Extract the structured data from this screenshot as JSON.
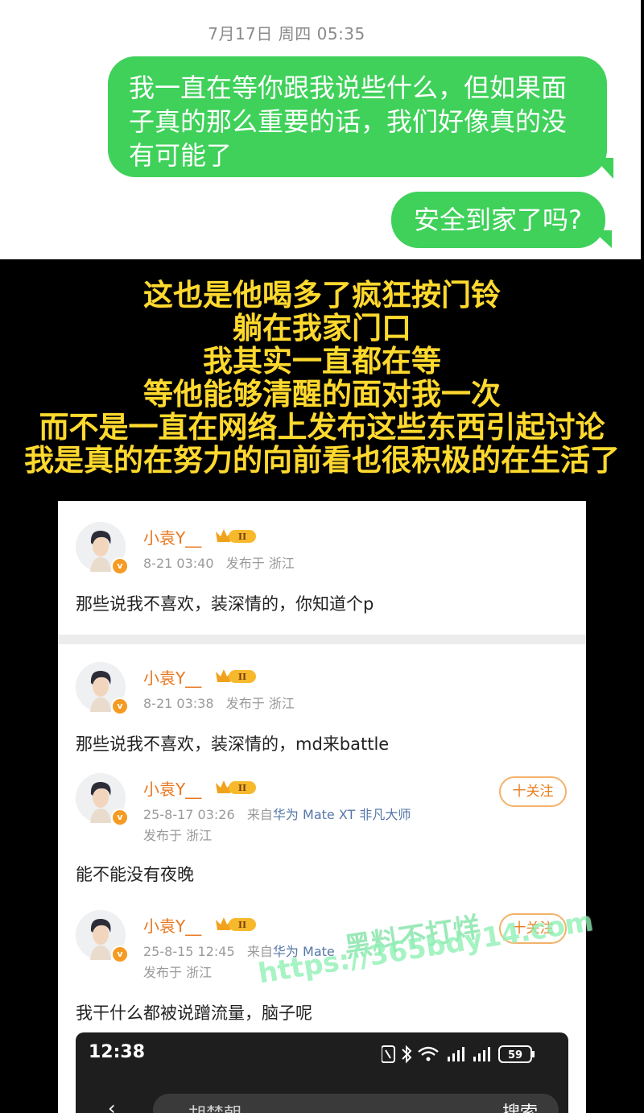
{
  "sms": {
    "timestamp": "7月17日 周四 05:35",
    "messages": [
      {
        "lines": [
          "我一直在等你跟我说些什么，但如果面",
          "子真的那么重要的话，我们好像真的没",
          "有可能了"
        ]
      },
      {
        "lines": [
          "安全到家了吗?"
        ]
      }
    ],
    "bubble_color": "#3fd15a"
  },
  "caption": {
    "lines": [
      "这也是他喝多了疯狂按门铃",
      "躺在我家门口",
      "我其实一直都在等",
      "等他能够清醒的面对我一次",
      "而不是一直在网络上发布这些东西引起讨论",
      "我是真的在努力的向前看也很积极的在生活了"
    ],
    "color": "#ffd92e"
  },
  "weibo": {
    "level_badge": "II",
    "posts": [
      {
        "user": "小袁Y__",
        "time": "8-21 03:40",
        "location": "发布于 浙江",
        "device": "",
        "text": "那些说我不喜欢，装深情的，你知道个p"
      },
      {
        "user": "小袁Y__",
        "time": "8-21 03:38",
        "location": "发布于 浙江",
        "device": "",
        "text": "那些说我不喜欢，装深情的，md来battle"
      },
      {
        "user": "小袁Y__",
        "time": "25-8-17 03:26",
        "source_prefix": "来自",
        "device": "华为 Mate XT 非凡大师",
        "location": "发布于 浙江",
        "text": "能不能没有夜晚",
        "follow": "十关注"
      },
      {
        "user": "小袁Y__",
        "time": "25-8-15 12:45",
        "source_prefix": "来自",
        "device": "华为 Mate",
        "location": "发布于 浙江",
        "text": "我干什么都被说蹭流量，脑子呢",
        "follow": "十关注"
      }
    ]
  },
  "phone": {
    "clock": "12:38",
    "battery": "59",
    "search_text": "胡楚朝",
    "search_button": "搜索"
  },
  "watermark": {
    "line1": "黑料不打烊",
    "line2": "https://365bdy14.com"
  }
}
